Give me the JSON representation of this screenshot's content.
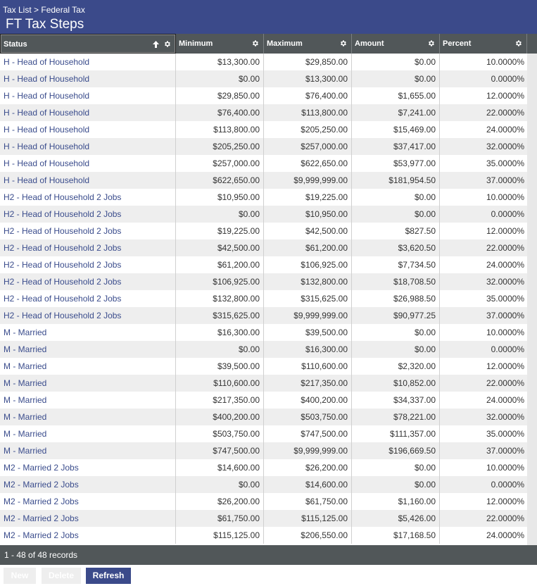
{
  "breadcrumb": {
    "parent": "Tax List",
    "separator": " > ",
    "current": "Federal Tax"
  },
  "page_title": "FT Tax Steps",
  "columns": {
    "status": "Status",
    "minimum": "Minimum",
    "maximum": "Maximum",
    "amount": "Amount",
    "percent": "Percent"
  },
  "sort": {
    "column": "status",
    "direction": "ascending"
  },
  "icons": {
    "column_menu": "gear-icon",
    "sort": "sort-up-arrow-icon"
  },
  "colors": {
    "header_bg": "#3b4a8a",
    "grid_header_bg": "#515759",
    "link_text": "#3a4c8c",
    "row_alt_bg": "#eeeeee",
    "primary_button": "#3b4a8a"
  },
  "rows": [
    {
      "status": "H - Head of Household",
      "minimum": "$13,300.00",
      "maximum": "$29,850.00",
      "amount": "$0.00",
      "percent": "10.0000%"
    },
    {
      "status": "H - Head of Household",
      "minimum": "$0.00",
      "maximum": "$13,300.00",
      "amount": "$0.00",
      "percent": "0.0000%"
    },
    {
      "status": "H - Head of Household",
      "minimum": "$29,850.00",
      "maximum": "$76,400.00",
      "amount": "$1,655.00",
      "percent": "12.0000%"
    },
    {
      "status": "H - Head of Household",
      "minimum": "$76,400.00",
      "maximum": "$113,800.00",
      "amount": "$7,241.00",
      "percent": "22.0000%"
    },
    {
      "status": "H - Head of Household",
      "minimum": "$113,800.00",
      "maximum": "$205,250.00",
      "amount": "$15,469.00",
      "percent": "24.0000%"
    },
    {
      "status": "H - Head of Household",
      "minimum": "$205,250.00",
      "maximum": "$257,000.00",
      "amount": "$37,417.00",
      "percent": "32.0000%"
    },
    {
      "status": "H - Head of Household",
      "minimum": "$257,000.00",
      "maximum": "$622,650.00",
      "amount": "$53,977.00",
      "percent": "35.0000%"
    },
    {
      "status": "H - Head of Household",
      "minimum": "$622,650.00",
      "maximum": "$9,999,999.00",
      "amount": "$181,954.50",
      "percent": "37.0000%"
    },
    {
      "status": "H2 - Head of Household 2 Jobs",
      "minimum": "$10,950.00",
      "maximum": "$19,225.00",
      "amount": "$0.00",
      "percent": "10.0000%"
    },
    {
      "status": "H2 - Head of Household 2 Jobs",
      "minimum": "$0.00",
      "maximum": "$10,950.00",
      "amount": "$0.00",
      "percent": "0.0000%"
    },
    {
      "status": "H2 - Head of Household 2 Jobs",
      "minimum": "$19,225.00",
      "maximum": "$42,500.00",
      "amount": "$827.50",
      "percent": "12.0000%"
    },
    {
      "status": "H2 - Head of Household 2 Jobs",
      "minimum": "$42,500.00",
      "maximum": "$61,200.00",
      "amount": "$3,620.50",
      "percent": "22.0000%"
    },
    {
      "status": "H2 - Head of Household 2 Jobs",
      "minimum": "$61,200.00",
      "maximum": "$106,925.00",
      "amount": "$7,734.50",
      "percent": "24.0000%"
    },
    {
      "status": "H2 - Head of Household 2 Jobs",
      "minimum": "$106,925.00",
      "maximum": "$132,800.00",
      "amount": "$18,708.50",
      "percent": "32.0000%"
    },
    {
      "status": "H2 - Head of Household 2 Jobs",
      "minimum": "$132,800.00",
      "maximum": "$315,625.00",
      "amount": "$26,988.50",
      "percent": "35.0000%"
    },
    {
      "status": "H2 - Head of Household 2 Jobs",
      "minimum": "$315,625.00",
      "maximum": "$9,999,999.00",
      "amount": "$90,977.25",
      "percent": "37.0000%"
    },
    {
      "status": "M - Married",
      "minimum": "$16,300.00",
      "maximum": "$39,500.00",
      "amount": "$0.00",
      "percent": "10.0000%"
    },
    {
      "status": "M - Married",
      "minimum": "$0.00",
      "maximum": "$16,300.00",
      "amount": "$0.00",
      "percent": "0.0000%"
    },
    {
      "status": "M - Married",
      "minimum": "$39,500.00",
      "maximum": "$110,600.00",
      "amount": "$2,320.00",
      "percent": "12.0000%"
    },
    {
      "status": "M - Married",
      "minimum": "$110,600.00",
      "maximum": "$217,350.00",
      "amount": "$10,852.00",
      "percent": "22.0000%"
    },
    {
      "status": "M - Married",
      "minimum": "$217,350.00",
      "maximum": "$400,200.00",
      "amount": "$34,337.00",
      "percent": "24.0000%"
    },
    {
      "status": "M - Married",
      "minimum": "$400,200.00",
      "maximum": "$503,750.00",
      "amount": "$78,221.00",
      "percent": "32.0000%"
    },
    {
      "status": "M - Married",
      "minimum": "$503,750.00",
      "maximum": "$747,500.00",
      "amount": "$111,357.00",
      "percent": "35.0000%"
    },
    {
      "status": "M - Married",
      "minimum": "$747,500.00",
      "maximum": "$9,999,999.00",
      "amount": "$196,669.50",
      "percent": "37.0000%"
    },
    {
      "status": "M2 - Married 2 Jobs",
      "minimum": "$14,600.00",
      "maximum": "$26,200.00",
      "amount": "$0.00",
      "percent": "10.0000%"
    },
    {
      "status": "M2 - Married 2 Jobs",
      "minimum": "$0.00",
      "maximum": "$14,600.00",
      "amount": "$0.00",
      "percent": "0.0000%"
    },
    {
      "status": "M2 - Married 2 Jobs",
      "minimum": "$26,200.00",
      "maximum": "$61,750.00",
      "amount": "$1,160.00",
      "percent": "12.0000%"
    },
    {
      "status": "M2 - Married 2 Jobs",
      "minimum": "$61,750.00",
      "maximum": "$115,125.00",
      "amount": "$5,426.00",
      "percent": "22.0000%"
    },
    {
      "status": "M2 - Married 2 Jobs",
      "minimum": "$115,125.00",
      "maximum": "$206,550.00",
      "amount": "$17,168.50",
      "percent": "24.0000%"
    }
  ],
  "footer": {
    "record_count": "1 - 48 of 48 records"
  },
  "buttons": {
    "new": "New",
    "delete": "Delete",
    "refresh": "Refresh"
  }
}
